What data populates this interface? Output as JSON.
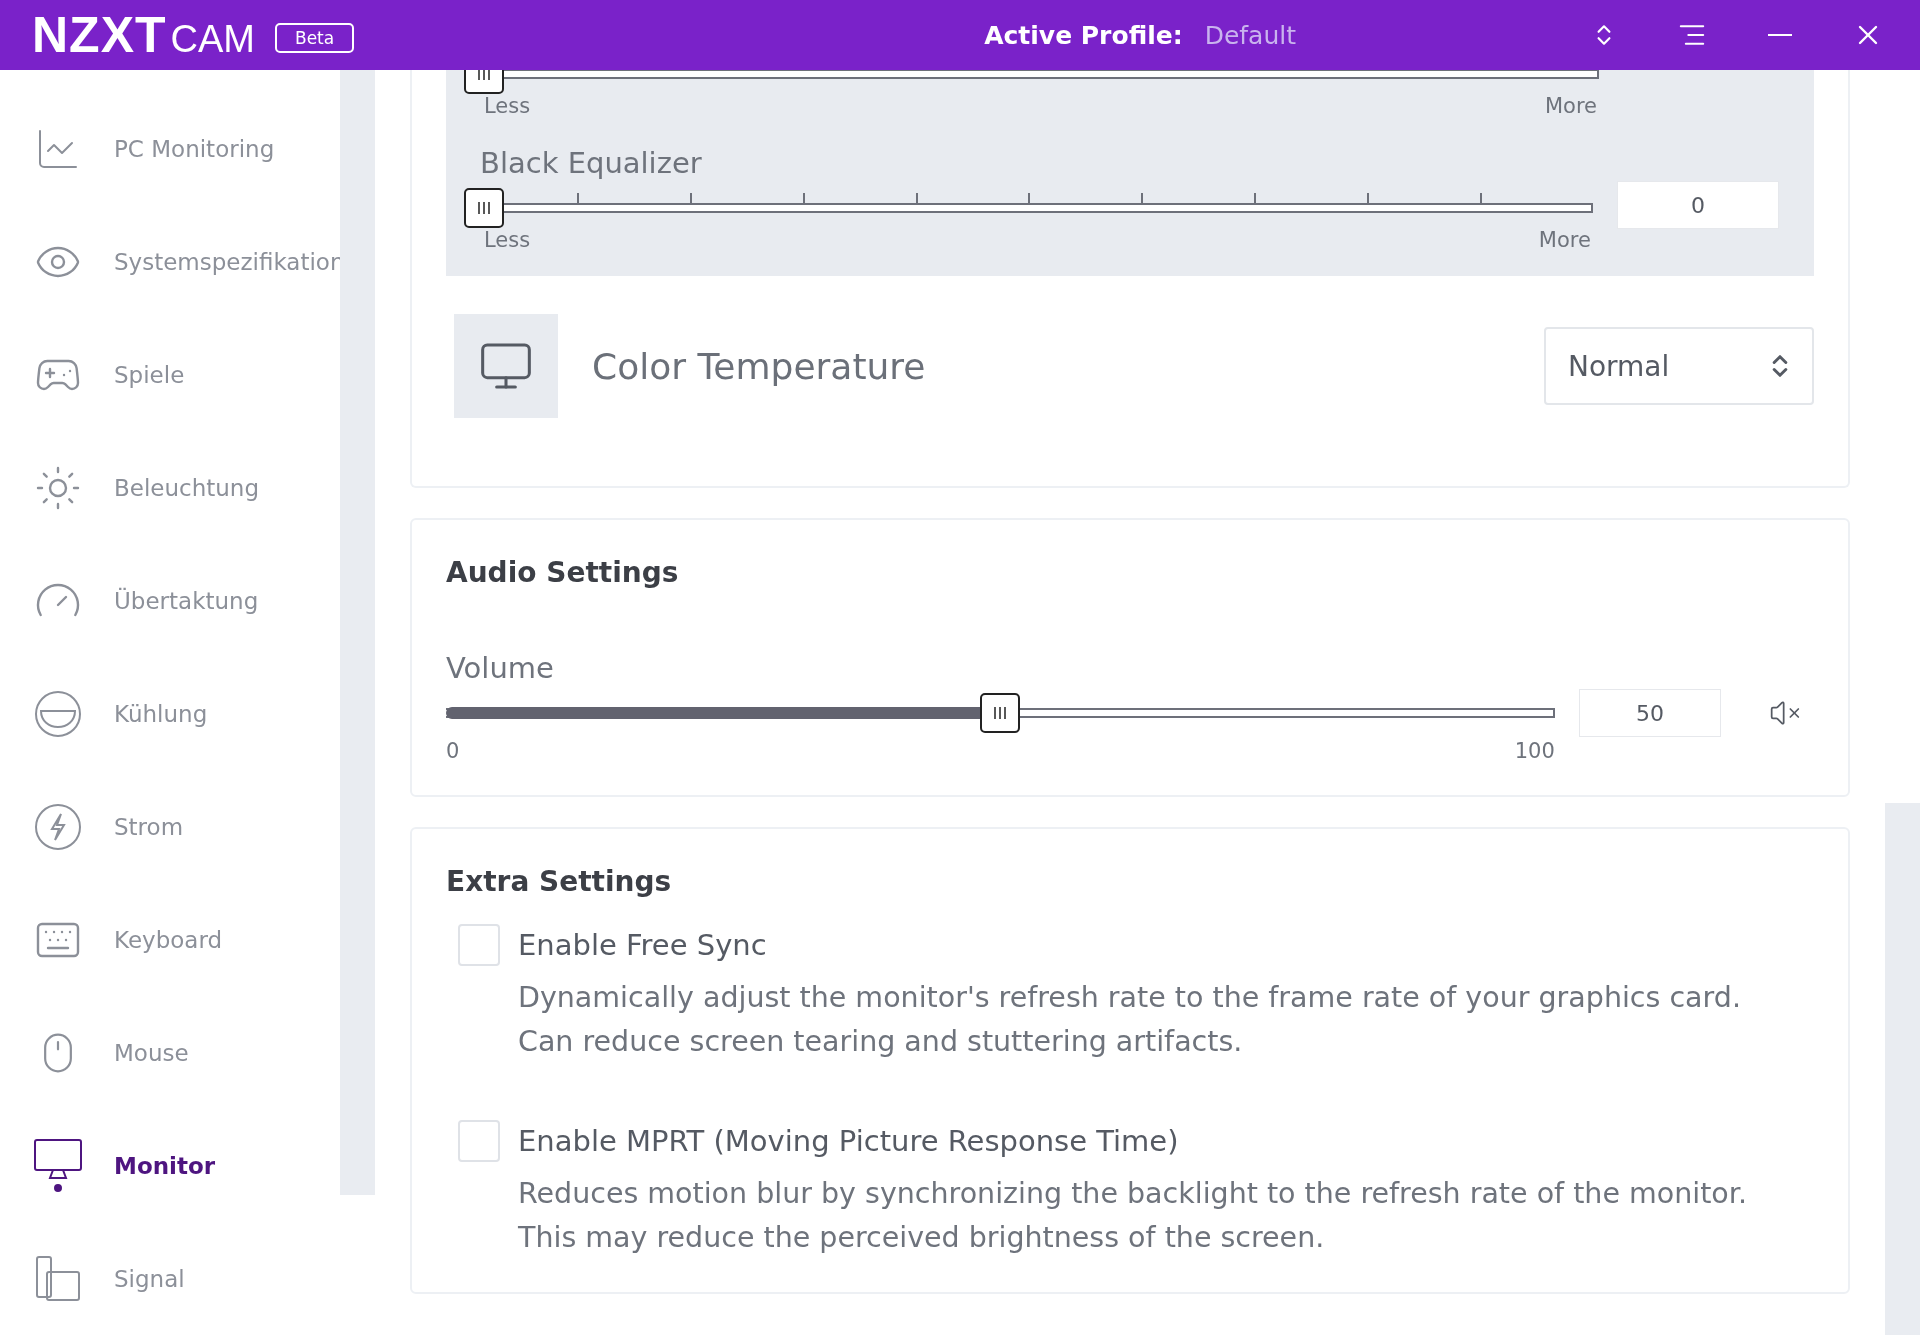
{
  "header": {
    "logo_main": "NZXT",
    "logo_sub": "CAM",
    "badge": "Beta",
    "profile_label": "Active Profile:",
    "profile_value": "Default"
  },
  "sidebar": {
    "items": [
      {
        "label": "PC Monitoring",
        "selected": false
      },
      {
        "label": "Systemspezifikation",
        "selected": false
      },
      {
        "label": "Spiele",
        "selected": false
      },
      {
        "label": "Beleuchtung",
        "selected": false
      },
      {
        "label": "Übertaktung",
        "selected": false
      },
      {
        "label": "Kühlung",
        "selected": false
      },
      {
        "label": "Strom",
        "selected": false
      },
      {
        "label": "Keyboard",
        "selected": false
      },
      {
        "label": "Mouse",
        "selected": false
      },
      {
        "label": "Monitor",
        "selected": true
      },
      {
        "label": "Signal",
        "selected": false
      }
    ]
  },
  "display_card": {
    "partial_slider": {
      "min_label": "Less",
      "max_label": "More",
      "level": 0
    },
    "sliders": [
      {
        "label": "Black Equalizer",
        "min_label": "Less",
        "max_label": "More",
        "value": "0",
        "level": 0
      }
    ],
    "color_temperature": {
      "label": "Color Temperature",
      "value": "Normal"
    }
  },
  "audio_card": {
    "title": "Audio Settings",
    "volume": {
      "label": "Volume",
      "min_label": "0",
      "max_label": "100",
      "value": "50",
      "level": 0.5,
      "muted": true
    }
  },
  "extra_card": {
    "title": "Extra Settings",
    "options": [
      {
        "label": "Enable Free Sync",
        "checked": false,
        "description": [
          "Dynamically adjust the monitor's refresh rate to the frame rate of your graphics card.",
          "Can reduce screen tearing and stuttering artifacts."
        ]
      },
      {
        "label": "Enable MPRT (Moving Picture Response Time)",
        "checked": false,
        "description": [
          "Reduces motion blur by synchronizing the backlight to the refresh rate of the monitor.",
          "This may reduce the perceived brightness of the screen."
        ]
      }
    ]
  }
}
